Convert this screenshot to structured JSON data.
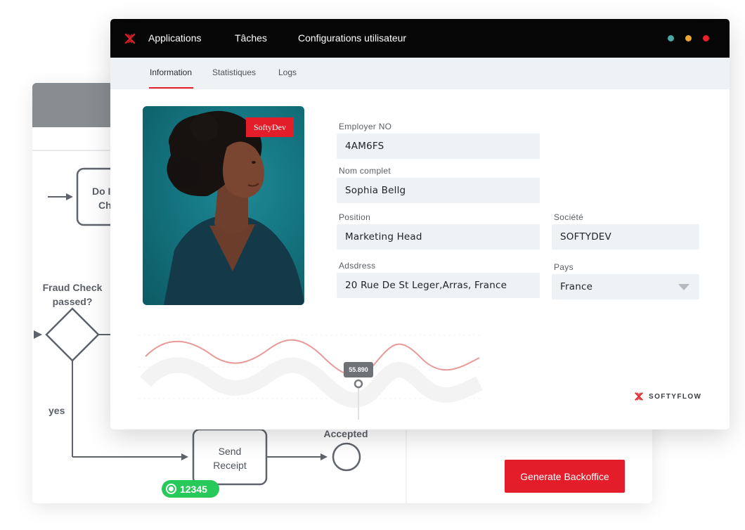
{
  "app": {
    "nav": [
      "Applications",
      "Tâches",
      "Configurations utilisateur"
    ],
    "window_dots": [
      "#49a9a3",
      "#f0a52c",
      "#e8202a"
    ],
    "accent": "#e31e2a"
  },
  "tabs": [
    "Information",
    "Statistiques",
    "Logs"
  ],
  "photo": {
    "tag": "SoftyDev",
    "alt_icon": "portrait-photo"
  },
  "form": {
    "employer_no": {
      "label": "Employer NO",
      "value": "4AM6FS"
    },
    "full_name": {
      "label": "Nom complet",
      "value": "Sophia Bellg"
    },
    "position": {
      "label": "Position",
      "value": "Marketing Head"
    },
    "company": {
      "label": "Société",
      "value": "SOFTYDEV"
    },
    "address": {
      "label": "Adsdress",
      "value": "20 Rue De St Leger,Arras, France"
    },
    "country": {
      "label": "Pays",
      "value": "France"
    }
  },
  "chart": {
    "tooltip": "55.890"
  },
  "brand": {
    "name": "SOFTYFLOW"
  },
  "diagram": {
    "task1_line1": "Do I",
    "task1_line2": "Ch",
    "gateway_line1": "Fraud Check",
    "gateway_line2": "passed?",
    "yes_label": "yes",
    "task2_line1": "Send",
    "task2_line2": "Receipt",
    "end_label": "Accepted",
    "badge_value": "12345",
    "button_label": "Generate Backoffice"
  }
}
